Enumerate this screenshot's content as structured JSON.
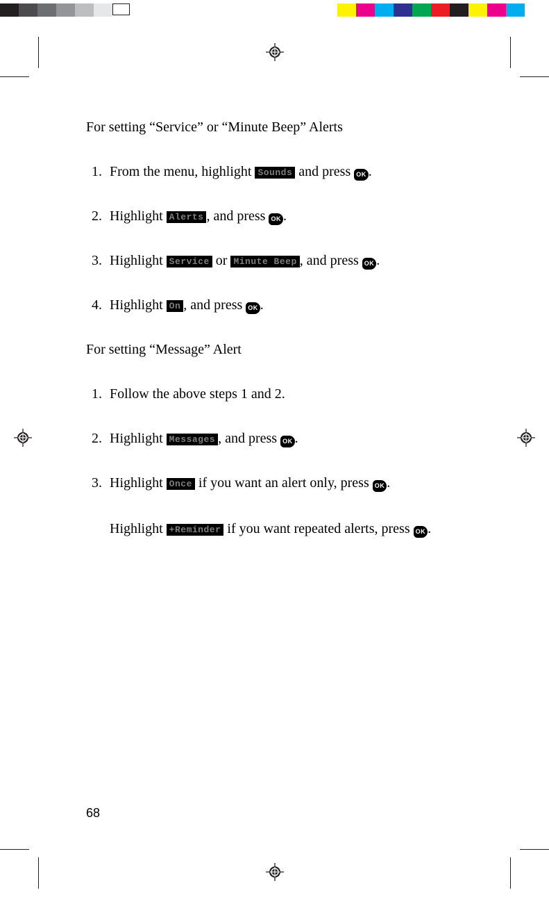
{
  "headingA": "For setting “Service” or “Minute Beep” Alerts",
  "headingB": "For setting “Message” Alert",
  "ok_label": "OK",
  "menu": {
    "sounds": "Sounds",
    "alerts": "Alerts",
    "service": "Service",
    "minute_beep": "Minute Beep",
    "on": "On",
    "messages": "Messages",
    "once": "Once",
    "reminder": "+Reminder"
  },
  "stepsA": {
    "1_a": "From the menu, highlight ",
    "1_b": " and press ",
    "2_a": "Highlight ",
    "2_b": ",  and press ",
    "3_a": "Highlight ",
    "3_b": " or ",
    "3_c": ", and press ",
    "4_a": "Highlight ",
    "4_b": ", and press "
  },
  "stepsB": {
    "1": "Follow the above steps 1 and 2.",
    "2_a": "Highlight ",
    "2_b": ", and press ",
    "3_a": "Highlight ",
    "3_b": " if you want an alert only, press ",
    "follow_a": "Highlight ",
    "follow_b": " if you want repeated alerts, press "
  },
  "page_number": "68",
  "colors": {
    "left_strip": [
      "#231f20",
      "#4c4c4e",
      "#6d6e71",
      "#939598",
      "#bcbec0",
      "#e6e7e8",
      "#ffffff"
    ],
    "right_strip": [
      "#fff200",
      "#ec008c",
      "#00aeef",
      "#2e3192",
      "#00a651",
      "#ed1c24",
      "#231f20",
      "#fff200",
      "#ec008c",
      "#00aeef"
    ]
  }
}
